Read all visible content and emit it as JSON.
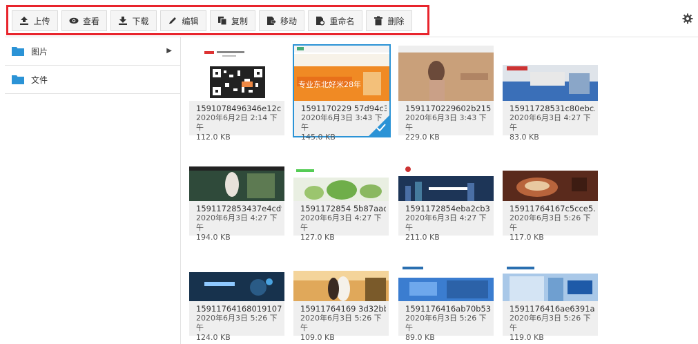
{
  "toolbar": {
    "buttons": [
      {
        "label": "上传",
        "icon": "upload-icon"
      },
      {
        "label": "查看",
        "icon": "eye-icon"
      },
      {
        "label": "下载",
        "icon": "download-icon"
      },
      {
        "label": "编辑",
        "icon": "pencil-icon"
      },
      {
        "label": "复制",
        "icon": "copy-icon"
      },
      {
        "label": "移动",
        "icon": "move-icon"
      },
      {
        "label": "重命名",
        "icon": "rename-icon"
      },
      {
        "label": "删除",
        "icon": "trash-icon"
      }
    ],
    "settings_icon": "gear-icon",
    "highlight_color": "#e8242c"
  },
  "sidebar": {
    "items": [
      {
        "label": "图片",
        "icon": "folder-icon",
        "expandable": true
      },
      {
        "label": "文件",
        "icon": "folder-icon",
        "expandable": false
      }
    ],
    "folder_color": "#2b93d6"
  },
  "files": [
    {
      "name": "1591078496346e12c...",
      "date": "2020年6月2日 2:14 下午",
      "size": "112.0 KB",
      "thumb": "qr"
    },
    {
      "name": "1591170229 57d94c3...",
      "date": "2020年6月3日 3:43 下午",
      "size": "145.0 KB",
      "thumb": "orange",
      "selected": true,
      "banner_text": "专业东北好米28年"
    },
    {
      "name": "1591170229602b215...",
      "date": "2020年6月3日 3:43 下午",
      "size": "229.0 KB",
      "thumb": "fashion"
    },
    {
      "name": "15911728531c80ebc...",
      "date": "2020年6月3日 4:27 下午",
      "size": "83.0 KB",
      "thumb": "blue-banner"
    },
    {
      "name": "1591172853437e4cdf...",
      "date": "2020年6月3日 4:27 下午",
      "size": "194.0 KB",
      "thumb": "green-fashion"
    },
    {
      "name": "1591172854 5b87aac...",
      "date": "2020年6月3日 4:27 下午",
      "size": "127.0 KB",
      "thumb": "plants"
    },
    {
      "name": "1591172854eba2cb3...",
      "date": "2020年6月3日 4:27 下午",
      "size": "211.0 KB",
      "thumb": "city"
    },
    {
      "name": "15911764167c5cce5...",
      "date": "2020年6月3日 5:26 下午",
      "size": "117.0 KB",
      "thumb": "food"
    },
    {
      "name": "15911764168019107...",
      "date": "2020年6月3日 5:26 下午",
      "size": "124.0 KB",
      "thumb": "tech"
    },
    {
      "name": "15911764169 3d32bbf...",
      "date": "2020年6月3日 5:26 下午",
      "size": "109.0 KB",
      "thumb": "wedding"
    },
    {
      "name": "1591176416ab70b53...",
      "date": "2020年6月3日 5:26 下午",
      "size": "89.0 KB",
      "thumb": "blue-card"
    },
    {
      "name": "1591176416ae6391a...",
      "date": "2020年6月3日 5:26 下午",
      "size": "119.0 KB",
      "thumb": "office"
    }
  ],
  "accent_color": "#2b93d6"
}
